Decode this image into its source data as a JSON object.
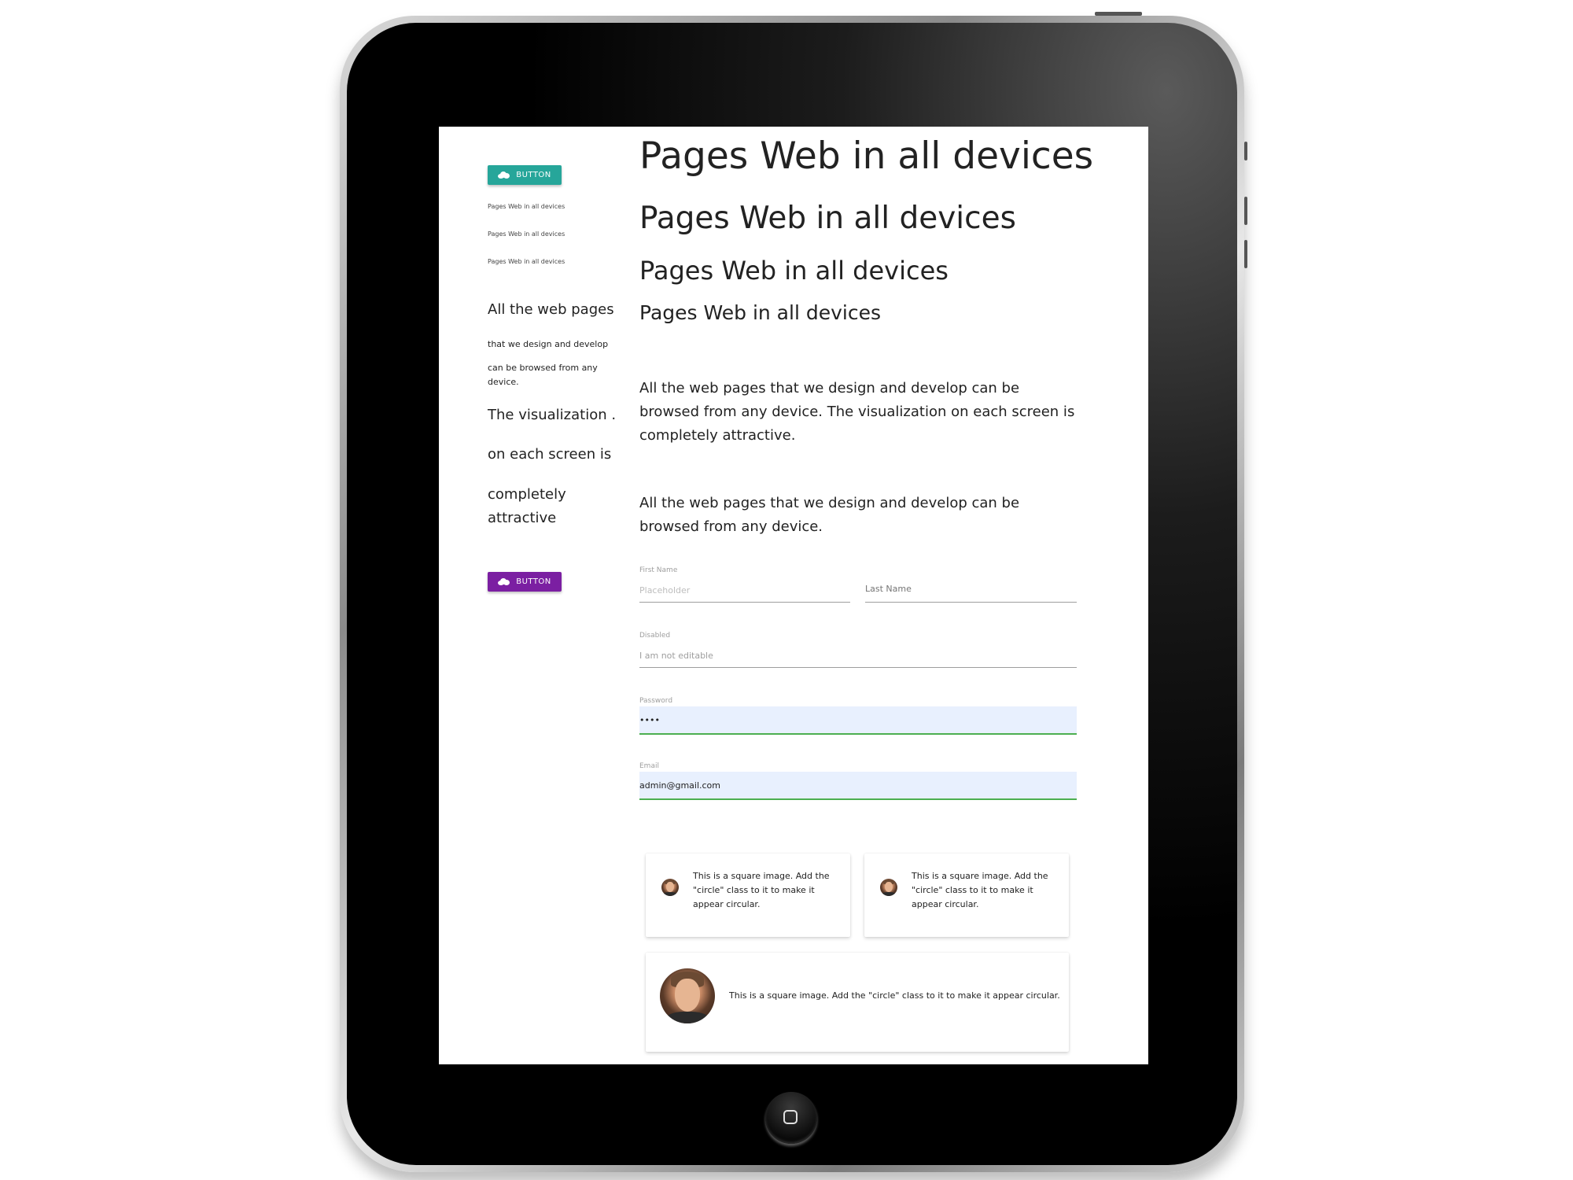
{
  "sidebar": {
    "button_top_label": "BUTTON",
    "links": [
      "Pages Web in all devices",
      "Pages Web in all devices",
      "Pages Web in all devices"
    ],
    "text_1": "All the web pages",
    "text_2": "that we design and develop",
    "text_3": "can be browsed from any device.",
    "text_4": "The visualization .",
    "text_5": "on each screen is",
    "text_6": "completely attractive",
    "button_bottom_label": "BUTTON"
  },
  "main": {
    "headings": [
      "Pages Web in all devices",
      "Pages Web in all devices",
      "Pages Web in all devices",
      "Pages Web in all devices"
    ],
    "paragraph_1": "All the web pages that we design and develop can be browsed from any device. The visualization on each screen is completely attractive.",
    "paragraph_2": "All the web pages that we design and develop can be browsed from any device."
  },
  "form": {
    "first_name_label": "First Name",
    "first_name_placeholder": "Placeholder",
    "last_name_label": "Last Name",
    "disabled_label": "Disabled",
    "disabled_value": "I am not editable",
    "password_label": "Password",
    "password_value": "••••",
    "email_label": "Email",
    "email_value": "admin@gmail.com"
  },
  "cards": [
    {
      "text": "This is a square image. Add the \"circle\" class to it to make it appear circular."
    },
    {
      "text": "This is a square image. Add the \"circle\" class to it to make it appear circular."
    },
    {
      "text": "This is a square image. Add the \"circle\" class to it to make it appear circular."
    }
  ],
  "colors": {
    "teal_button": "#26a69a",
    "purple_button": "#7b1fa2",
    "autofill_background": "#e8f0fe",
    "focus_underline": "#4caf50"
  },
  "icons": {
    "button_icon": "cloud-icon",
    "device_home": "home-button-icon"
  }
}
